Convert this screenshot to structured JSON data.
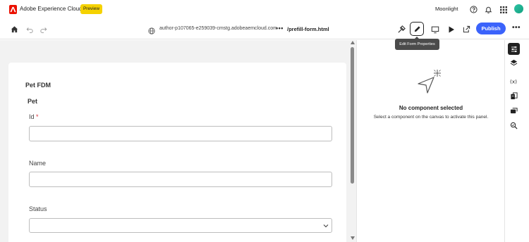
{
  "topbar": {
    "brand": "Adobe Experience Cloud",
    "badge": "Preview",
    "org": "Moonlight",
    "icons": [
      "adobe-logo",
      "help-icon",
      "bell-icon",
      "apps-grid-icon",
      "user-avatar"
    ]
  },
  "toolbar": {
    "url_host": "author-p107065-e259039-cmstg.adobeaemcloud.com",
    "url_more": "•••",
    "url_path": "/prefill-form.html",
    "publish_label": "Publish",
    "more_label": "•••",
    "tooltip": "Edit Form Properties",
    "icons": [
      "home-icon",
      "undo-icon",
      "redo-icon",
      "globe-icon",
      "pick-icon",
      "edit-pencil-icon",
      "desktop-icon",
      "play-icon",
      "open-external-icon"
    ]
  },
  "form": {
    "title": "Pet FDM",
    "panel_title": "Pet",
    "fields": [
      {
        "label": "Id",
        "required": "*",
        "value": ""
      },
      {
        "label": "Name",
        "value": ""
      },
      {
        "label": "Status",
        "value": ""
      }
    ]
  },
  "properties_panel": {
    "empty_title": "No component selected",
    "empty_desc": "Select a component on the canvas to activate this panel."
  },
  "rail": {
    "icons": [
      "properties-sliders-icon",
      "layers-icon",
      "variables-icon",
      "data-source-icon",
      "rules-icon",
      "search-replace-icon"
    ]
  },
  "colors": {
    "accent": "#3b63fb",
    "brand": "#eb1000",
    "badge": "#f5d200"
  }
}
